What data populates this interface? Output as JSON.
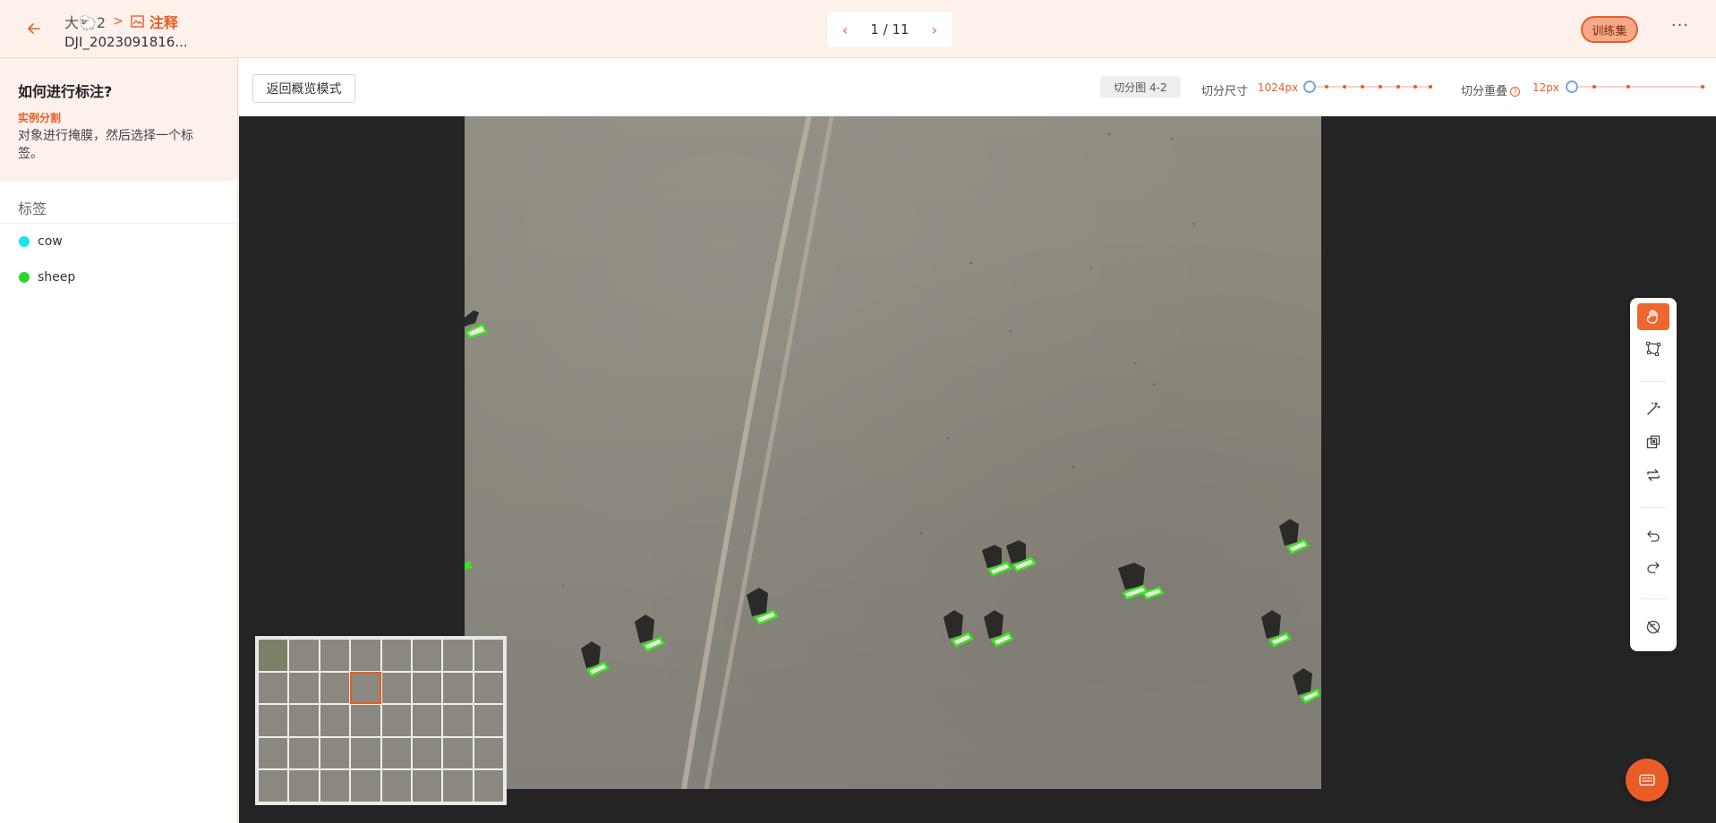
{
  "header": {
    "project_name": "大🐑2",
    "breadcrumb_separator": ">",
    "current_section": "注释",
    "file_name": "DJI_2023091816...",
    "pager": {
      "prev": "‹",
      "text": "1 / 11",
      "next": "›"
    },
    "train_set_label": "训练集",
    "more_label": "···"
  },
  "sidebar": {
    "howto_title": "如何进行标注?",
    "howto_mode": "实例分割",
    "howto_desc": "对象进行掩膜，然后选择一个标签。",
    "labels_title": "标签",
    "labels": [
      {
        "name": "cow",
        "color": "#19e6e6"
      },
      {
        "name": "sheep",
        "color": "#2ed62e"
      }
    ]
  },
  "toolbar": {
    "overview_button": "返回概览模式",
    "tile_chip": "切分图 4-2",
    "tile_size_label": "切分尺寸",
    "tile_size_value": "1024px",
    "tile_overlap_label": "切分重叠",
    "tile_overlap_value": "12px",
    "help_glyph": "?"
  },
  "minimap": {
    "cols": 8,
    "rows": 5,
    "active_index": 11
  },
  "colors": {
    "accent": "#e85d26",
    "mask_outline": "#39e61e",
    "canvas_bg": "#242424"
  },
  "tools": [
    {
      "icon": "hand-icon",
      "active": true
    },
    {
      "icon": "polygon-icon",
      "active": false
    },
    {
      "icon": "magic-wand-icon",
      "active": false
    },
    {
      "icon": "box-select-icon",
      "active": false
    },
    {
      "icon": "swap-icon",
      "active": false
    },
    {
      "icon": "undo-icon",
      "active": false
    },
    {
      "icon": "redo-icon",
      "active": false
    },
    {
      "icon": "hide-icon",
      "active": false
    }
  ],
  "keyboard_button_icon": "keyboard-icon"
}
